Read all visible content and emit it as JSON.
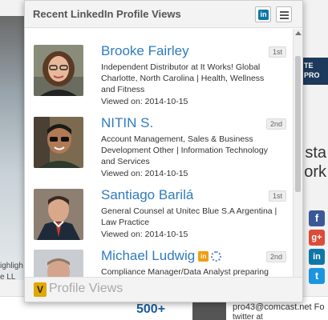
{
  "popup": {
    "title": "Recent LinkedIn Profile Views",
    "linkedin_button": "in",
    "footer": {
      "logo": "V",
      "label": "Profile Views"
    }
  },
  "profiles": [
    {
      "name": "Brooke Fairley",
      "degree": "1st",
      "description": "Independent Distributor at It Works! Global Charlotte, North Carolina | Health, Wellness and Fitness",
      "viewed": "Viewed on: 2014-10-15"
    },
    {
      "name": "NITIN S.",
      "degree": "2nd",
      "description": "Account Management, Sales & Business Development Other | Information Technology and Services",
      "viewed": "Viewed on: 2014-10-15"
    },
    {
      "name": "Santiago Barilá",
      "degree": "1st",
      "description": "General Counsel at Unitec Blue S.A Argentina | Law Practice",
      "viewed": "Viewed on: 2014-10-15"
    },
    {
      "name": "Michael Ludwig",
      "degree": "2nd",
      "description": "Compliance Manager/Data Analyst preparing for",
      "badge_li": "in",
      "viewed": ""
    }
  ],
  "background": {
    "left_text_1": "ighligh",
    "left_text_2": "e LL",
    "right_banner": "TE PRO",
    "right_text_1": "sta",
    "right_text_2": "ork",
    "bottom_stat": "500+",
    "bottom_email": "pro43@comcast.net Fo",
    "bottom_email_2": "twitter at",
    "social": [
      "f",
      "g+",
      "in",
      "t"
    ]
  },
  "colors": {
    "link_blue": "#2f7bbd",
    "linkedin_blue": "#0e76a8",
    "facebook": "#3b5998",
    "google_plus": "#dd4b39",
    "twitter": "#1b95e0"
  }
}
